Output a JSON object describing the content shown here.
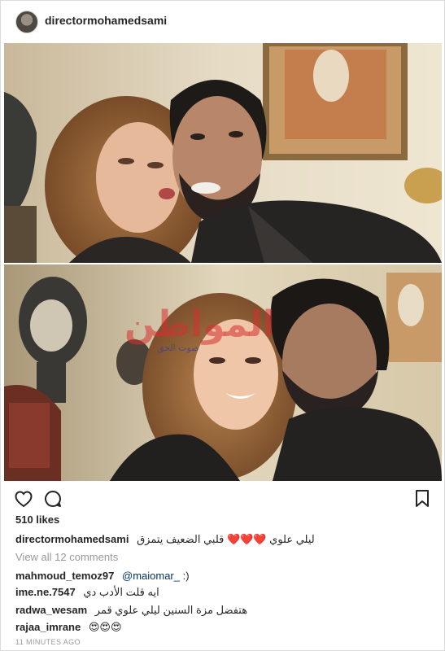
{
  "post": {
    "username": "directormohamedsami",
    "watermark": "المواطن",
    "watermark_sub": "صوت الحق",
    "likes": "510 likes",
    "caption_username": "directormohamedsami",
    "caption_text": "ليلي علوي ❤️❤️❤️ قلبي الضعيف يتمزق",
    "view_all": "View all 12 comments",
    "timestamp": "11 MINUTES AGO"
  },
  "comments": [
    {
      "username": "mahmoud_temoz97",
      "mention": "@maiomar_",
      "text": ":)"
    },
    {
      "username": "ime.ne.7547",
      "text": "ايه قلت الأدب دي"
    },
    {
      "username": "radwa_wesam",
      "text": "هتفضل مزة السنين ليلي علوي قمر"
    },
    {
      "username": "rajaa_imrane",
      "text": "😍😍😍"
    }
  ],
  "icons": {
    "like": "heart-outline-icon",
    "comment": "speech-bubble-icon",
    "save": "bookmark-icon"
  },
  "colors": {
    "text": "#262626",
    "muted": "#999999",
    "border": "#dbdbdb",
    "heart": "#ed4956"
  }
}
